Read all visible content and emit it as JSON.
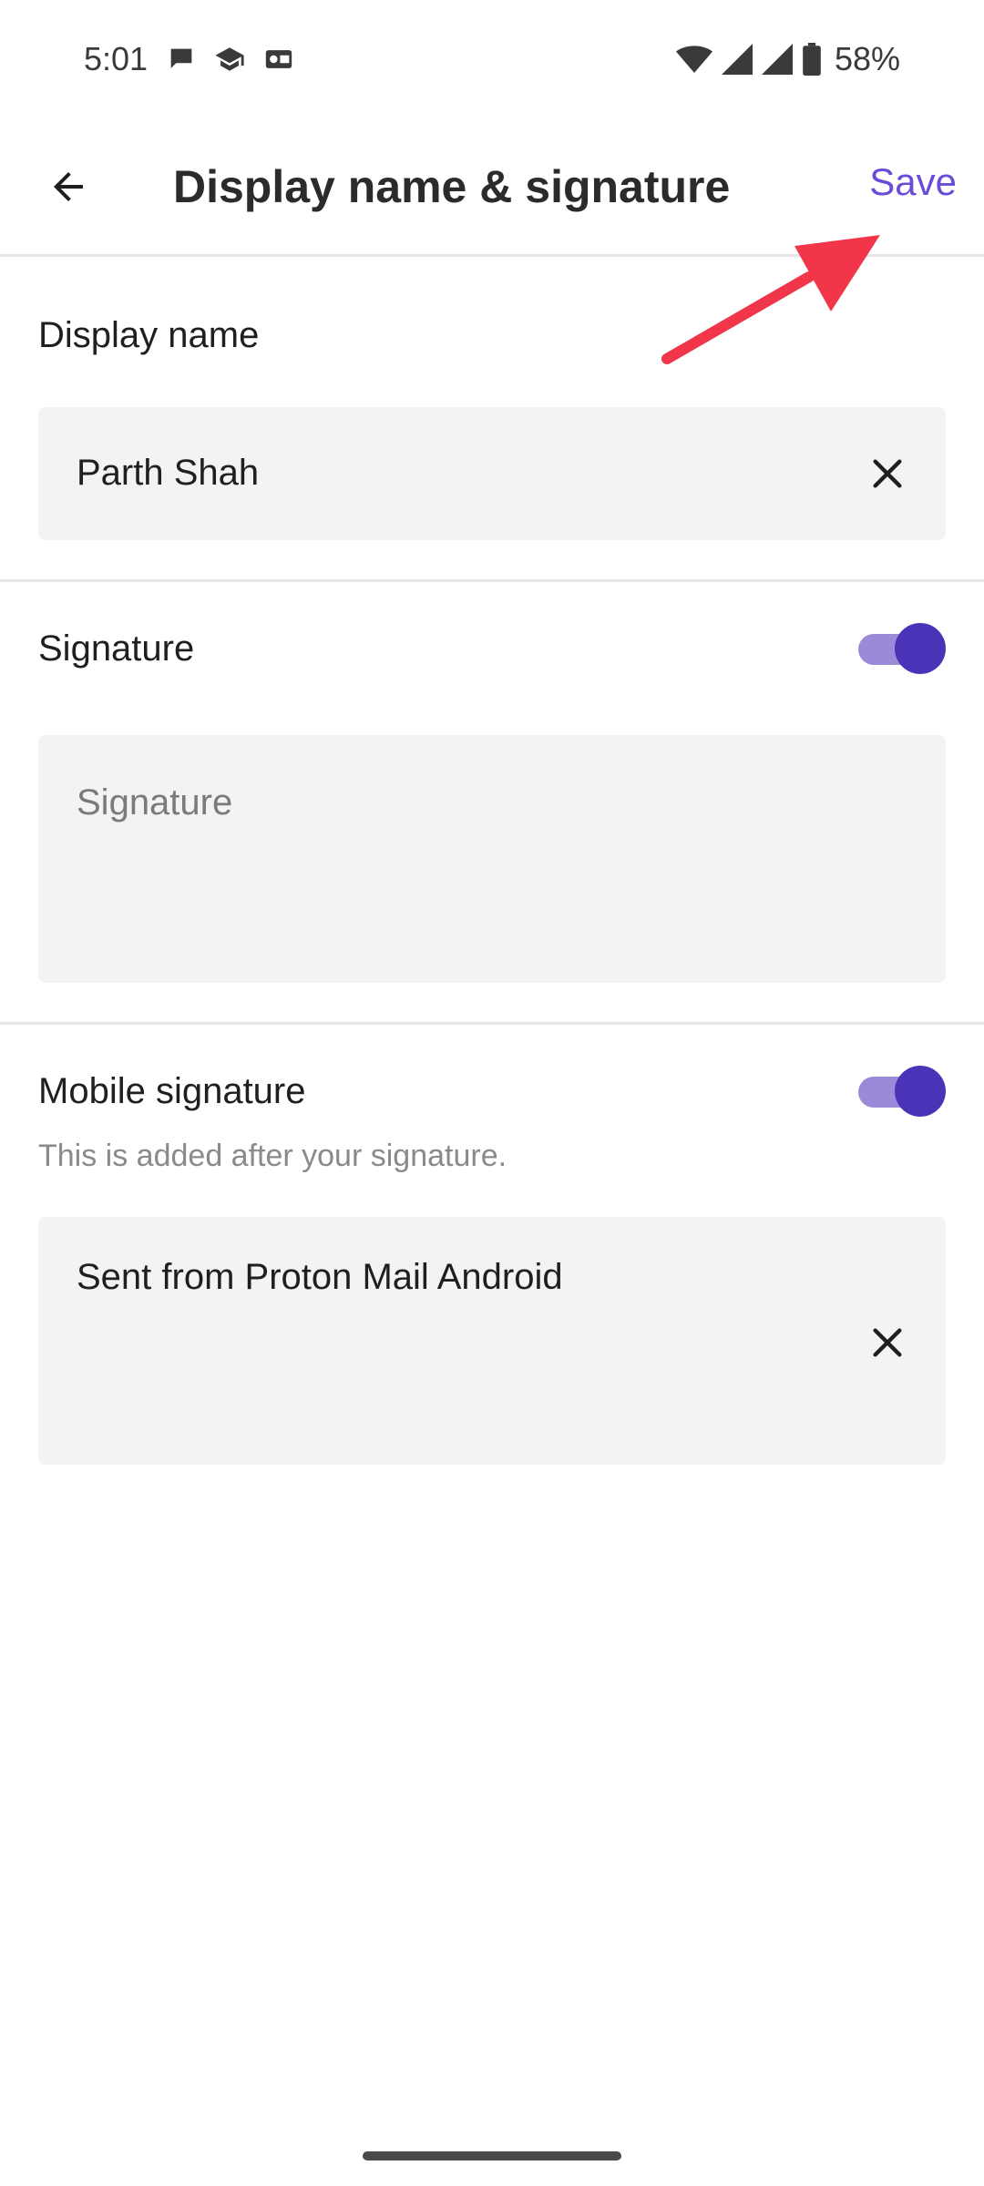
{
  "status_bar": {
    "time": "5:01",
    "battery": "58%",
    "left_icons": [
      "chat-icon",
      "graduation-icon",
      "outlook-icon"
    ],
    "right_icons": [
      "wifi-icon",
      "signal-icon",
      "signal-icon",
      "battery-icon"
    ]
  },
  "app_bar": {
    "title": "Display name & signature",
    "save_label": "Save",
    "back_icon": "arrow-left-icon"
  },
  "display_name": {
    "label": "Display name",
    "value": "Parth Shah"
  },
  "signature": {
    "label": "Signature",
    "placeholder": "Signature",
    "enabled": true
  },
  "mobile_signature": {
    "label": "Mobile signature",
    "description": "This is added after your signature.",
    "value": "Sent from Proton Mail Android",
    "enabled": true
  },
  "colors": {
    "accent": "#6a4cd6",
    "toggle_thumb": "#4b33b8",
    "toggle_track": "#9b8ad9",
    "field_bg": "#f4f3f2",
    "annotation_arrow": "#f2364a"
  }
}
